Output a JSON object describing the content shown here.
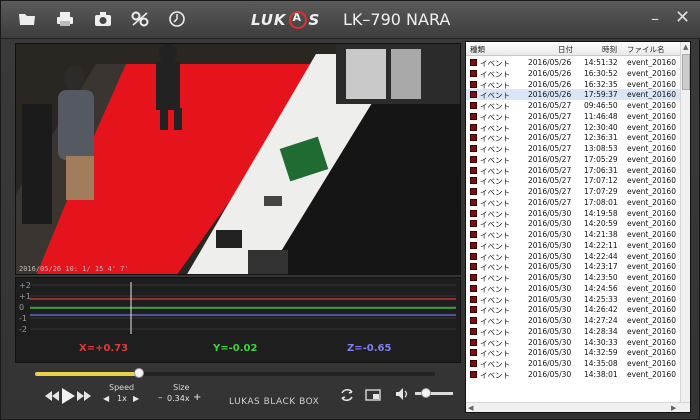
{
  "window": {
    "brand_left": "LUK",
    "brand_right": "S",
    "model": "LK–790 NARA",
    "minimize_glyph": "–",
    "close_glyph": "✕"
  },
  "toolbar": {
    "icons": [
      "folder-icon",
      "printer-icon",
      "camera-icon",
      "settings-icon",
      "clock-icon"
    ]
  },
  "video": {
    "osd_text": "2016/05/26 10:   1/ 15 4' 7'"
  },
  "graph": {
    "axis_labels": [
      "+2",
      "+1",
      "0",
      "-1",
      "-2"
    ],
    "x_readout": "X=+0.73",
    "y_readout": "Y=-0.02",
    "z_readout": "Z=-0.65",
    "colors": {
      "x": "#e03a3a",
      "y": "#3ad43a",
      "z": "#6f6fe8"
    }
  },
  "controls": {
    "seek_fraction": 0.26,
    "speed_label": "Speed",
    "speed_value": "1x",
    "size_label": "Size",
    "size_value": "0.34x",
    "brand_text": "LUKAS BLACK BOX",
    "volume_fraction": 0.3
  },
  "list": {
    "headers": {
      "type": "種類",
      "date": "日付",
      "time": "時刻",
      "file": "ファイル名"
    },
    "selected_index": 3,
    "rows": [
      {
        "type": "イベント",
        "date": "2016/05/26",
        "time": "14:51:32",
        "file": "event_20160"
      },
      {
        "type": "イベント",
        "date": "2016/05/26",
        "time": "16:30:52",
        "file": "event_20160"
      },
      {
        "type": "イベント",
        "date": "2016/05/26",
        "time": "16:32:35",
        "file": "event_20160"
      },
      {
        "type": "イベント",
        "date": "2016/05/26",
        "time": "17:59:37",
        "file": "event_20160"
      },
      {
        "type": "イベント",
        "date": "2016/05/27",
        "time": "09:46:50",
        "file": "event_20160"
      },
      {
        "type": "イベント",
        "date": "2016/05/27",
        "time": "11:46:48",
        "file": "event_20160"
      },
      {
        "type": "イベント",
        "date": "2016/05/27",
        "time": "12:30:40",
        "file": "event_20160"
      },
      {
        "type": "イベント",
        "date": "2016/05/27",
        "time": "12:36:31",
        "file": "event_20160"
      },
      {
        "type": "イベント",
        "date": "2016/05/27",
        "time": "13:08:53",
        "file": "event_20160"
      },
      {
        "type": "イベント",
        "date": "2016/05/27",
        "time": "17:05:29",
        "file": "event_20160"
      },
      {
        "type": "イベント",
        "date": "2016/05/27",
        "time": "17:06:31",
        "file": "event_20160"
      },
      {
        "type": "イベント",
        "date": "2016/05/27",
        "time": "17:07:12",
        "file": "event_20160"
      },
      {
        "type": "イベント",
        "date": "2016/05/27",
        "time": "17:07:29",
        "file": "event_20160"
      },
      {
        "type": "イベント",
        "date": "2016/05/27",
        "time": "17:08:01",
        "file": "event_20160"
      },
      {
        "type": "イベント",
        "date": "2016/05/30",
        "time": "14:19:58",
        "file": "event_20160"
      },
      {
        "type": "イベント",
        "date": "2016/05/30",
        "time": "14:20:59",
        "file": "event_20160"
      },
      {
        "type": "イベント",
        "date": "2016/05/30",
        "time": "14:21:38",
        "file": "event_20160"
      },
      {
        "type": "イベント",
        "date": "2016/05/30",
        "time": "14:22:11",
        "file": "event_20160"
      },
      {
        "type": "イベント",
        "date": "2016/05/30",
        "time": "14:22:44",
        "file": "event_20160"
      },
      {
        "type": "イベント",
        "date": "2016/05/30",
        "time": "14:23:17",
        "file": "event_20160"
      },
      {
        "type": "イベント",
        "date": "2016/05/30",
        "time": "14:23:50",
        "file": "event_20160"
      },
      {
        "type": "イベント",
        "date": "2016/05/30",
        "time": "14:24:56",
        "file": "event_20160"
      },
      {
        "type": "イベント",
        "date": "2016/05/30",
        "time": "14:25:33",
        "file": "event_20160"
      },
      {
        "type": "イベント",
        "date": "2016/05/30",
        "time": "14:26:42",
        "file": "event_20160"
      },
      {
        "type": "イベント",
        "date": "2016/05/30",
        "time": "14:27:24",
        "file": "event_20160"
      },
      {
        "type": "イベント",
        "date": "2016/05/30",
        "time": "14:28:34",
        "file": "event_20160"
      },
      {
        "type": "イベント",
        "date": "2016/05/30",
        "time": "14:30:33",
        "file": "event_20160"
      },
      {
        "type": "イベント",
        "date": "2016/05/30",
        "time": "14:32:59",
        "file": "event_20160"
      },
      {
        "type": "イベント",
        "date": "2016/05/30",
        "time": "14:35:08",
        "file": "event_20160"
      },
      {
        "type": "イベント",
        "date": "2016/05/30",
        "time": "14:38:01",
        "file": "event_20160"
      }
    ]
  }
}
